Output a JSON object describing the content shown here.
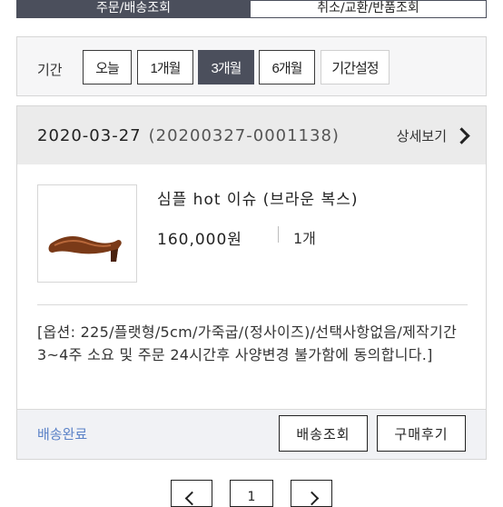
{
  "tabs": [
    {
      "label": "주문/배송조회"
    },
    {
      "label": "취소/교환/반품조회"
    }
  ],
  "period": {
    "label": "기간",
    "options": [
      "오늘",
      "1개월",
      "3개월",
      "6개월",
      "기간설정"
    ],
    "selected": "3개월"
  },
  "order": {
    "date": "2020-03-27",
    "number": "(20200327-0001138)",
    "detail_label": "상세보기",
    "product": {
      "name": "심플 hot 이슈 (브라운 복스)",
      "price": "160,000원",
      "quantity": "1개",
      "options": "[옵션: 225/플랫형/5cm/가죽굽/(정사이즈)/선택사항없음/제작기간 3~4주 소요 및 주문 24시간후 사양변경 불가함에 동의합니다.]"
    },
    "status": "배송완료",
    "buttons": {
      "track": "배송조회",
      "review": "구매후기"
    }
  },
  "pagination": {
    "current": "1"
  },
  "colors": {
    "selected_bg": "#4b4f5c",
    "status_text": "#5b82c7",
    "header_bg": "#ebebeb"
  },
  "icons": {
    "detail_arrow": "chevron-right-icon",
    "prev": "chevron-left-icon",
    "next": "chevron-right-icon"
  }
}
